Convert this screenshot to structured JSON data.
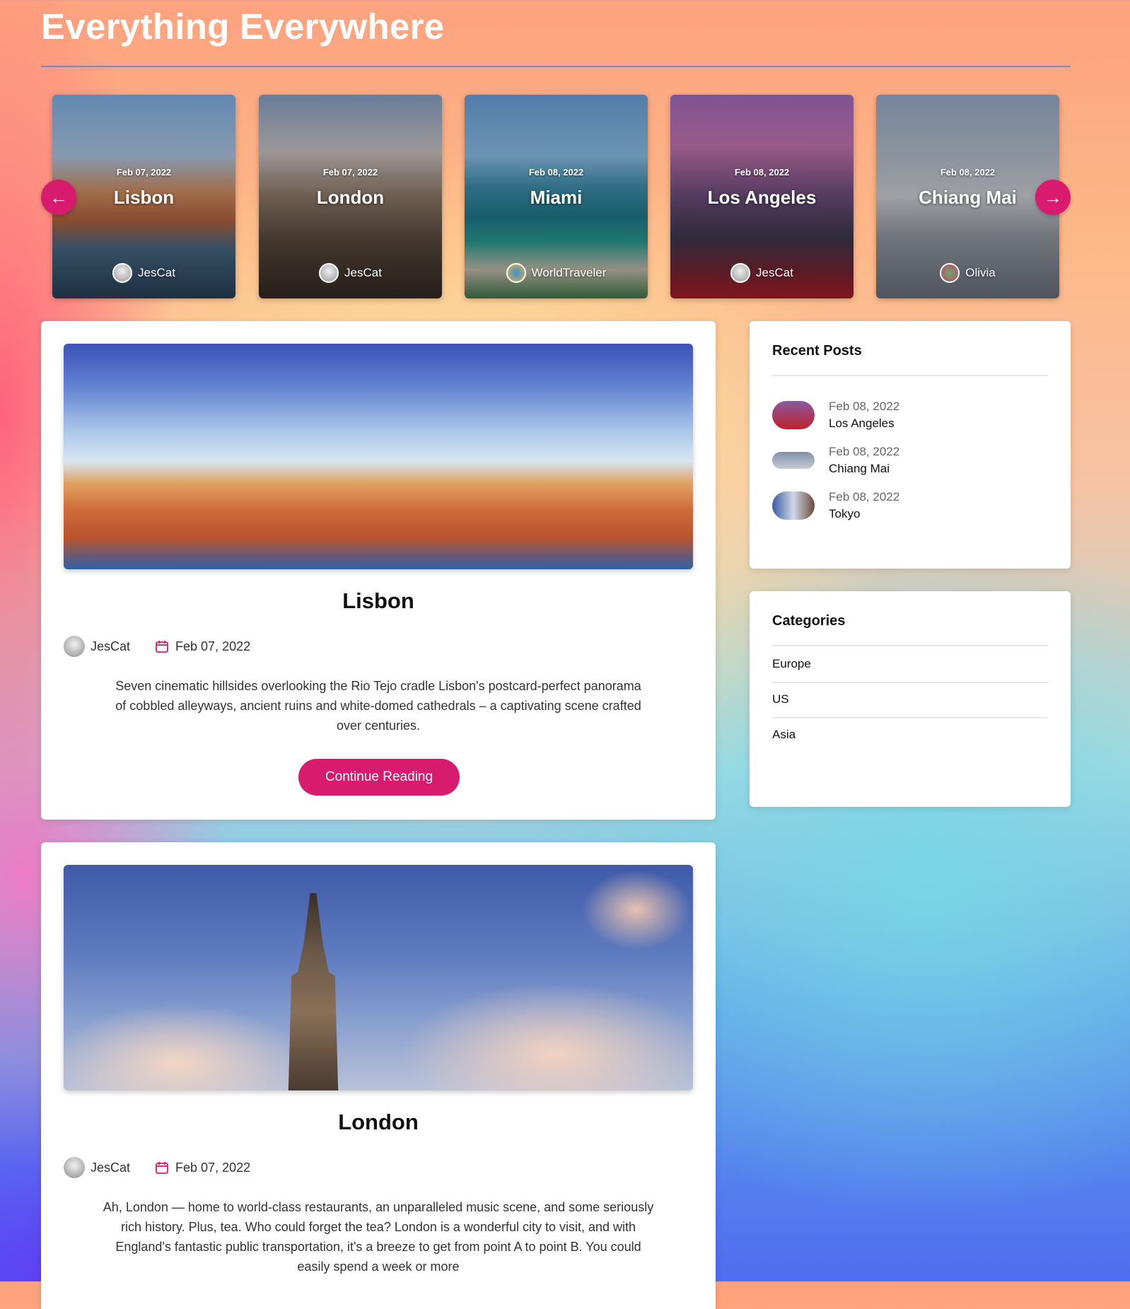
{
  "site": {
    "title": "Everything Everywhere"
  },
  "slider": {
    "prev_icon": "arrow-left-icon",
    "next_icon": "arrow-right-icon",
    "slides": [
      {
        "date": "Feb 07, 2022",
        "title": "Lisbon",
        "author": "JesCat"
      },
      {
        "date": "Feb 07, 2022",
        "title": "London",
        "author": "JesCat"
      },
      {
        "date": "Feb 08, 2022",
        "title": "Miami",
        "author": "WorldTraveler"
      },
      {
        "date": "Feb 08, 2022",
        "title": "Los Angeles",
        "author": "JesCat"
      },
      {
        "date": "Feb 08, 2022",
        "title": "Chiang Mai",
        "author": "Olivia"
      }
    ]
  },
  "posts": [
    {
      "title": "Lisbon",
      "author": "JesCat",
      "date": "Feb 07, 2022",
      "excerpt": "Seven cinematic hillsides overlooking the Rio Tejo cradle Lisbon's postcard-perfect panorama of cobbled alleyways, ancient ruins and white-domed cathedrals – a captivating scene crafted over centuries.",
      "button": "Continue Reading"
    },
    {
      "title": "London",
      "author": "JesCat",
      "date": "Feb 07, 2022",
      "excerpt": "Ah, London — home to world-class restaurants, an unparalleled music scene, and some seriously rich history. Plus, tea. Who could forget the tea? London is a wonderful city to visit, and with England's fantastic public transportation, it's a breeze to get from point A to point B. You could easily spend a week or more"
    }
  ],
  "recent_posts": {
    "title": "Recent Posts",
    "items": [
      {
        "date": "Feb 08, 2022",
        "name": "Los Angeles"
      },
      {
        "date": "Feb 08, 2022",
        "name": "Chiang Mai"
      },
      {
        "date": "Feb 08, 2022",
        "name": "Tokyo"
      }
    ]
  },
  "categories": {
    "title": "Categories",
    "items": [
      "Europe",
      "US",
      "Asia"
    ]
  },
  "colors": {
    "accent": "#d81b6e",
    "rule": "#6f88d8"
  }
}
